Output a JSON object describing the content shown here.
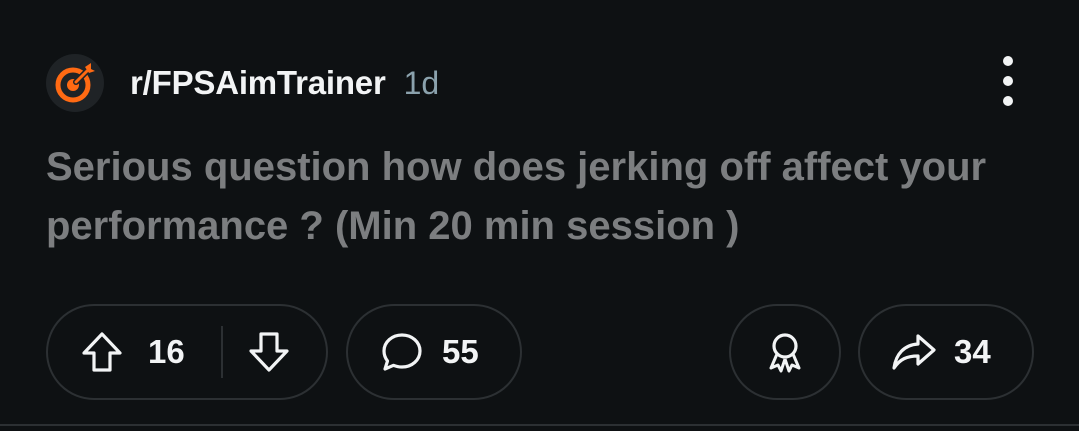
{
  "post": {
    "subreddit": "r/FPSAimTrainer",
    "age": "1d",
    "title": "Serious question how does jerking off affect your performance ? (Min 20 min session )",
    "upvotes": "16",
    "comments": "55",
    "shares": "34"
  },
  "icons": {
    "avatar": "target-icon",
    "more": "more-vertical-icon",
    "upvote": "arrow-up-icon",
    "downvote": "arrow-down-icon",
    "comment": "comment-bubble-icon",
    "award": "award-icon",
    "share": "share-arrow-icon"
  },
  "colors": {
    "background": "#0e1113",
    "accent": "#ff6a13",
    "title_text": "#7c7e80",
    "meta_text": "#8ba2ad",
    "border": "#2c3033"
  }
}
